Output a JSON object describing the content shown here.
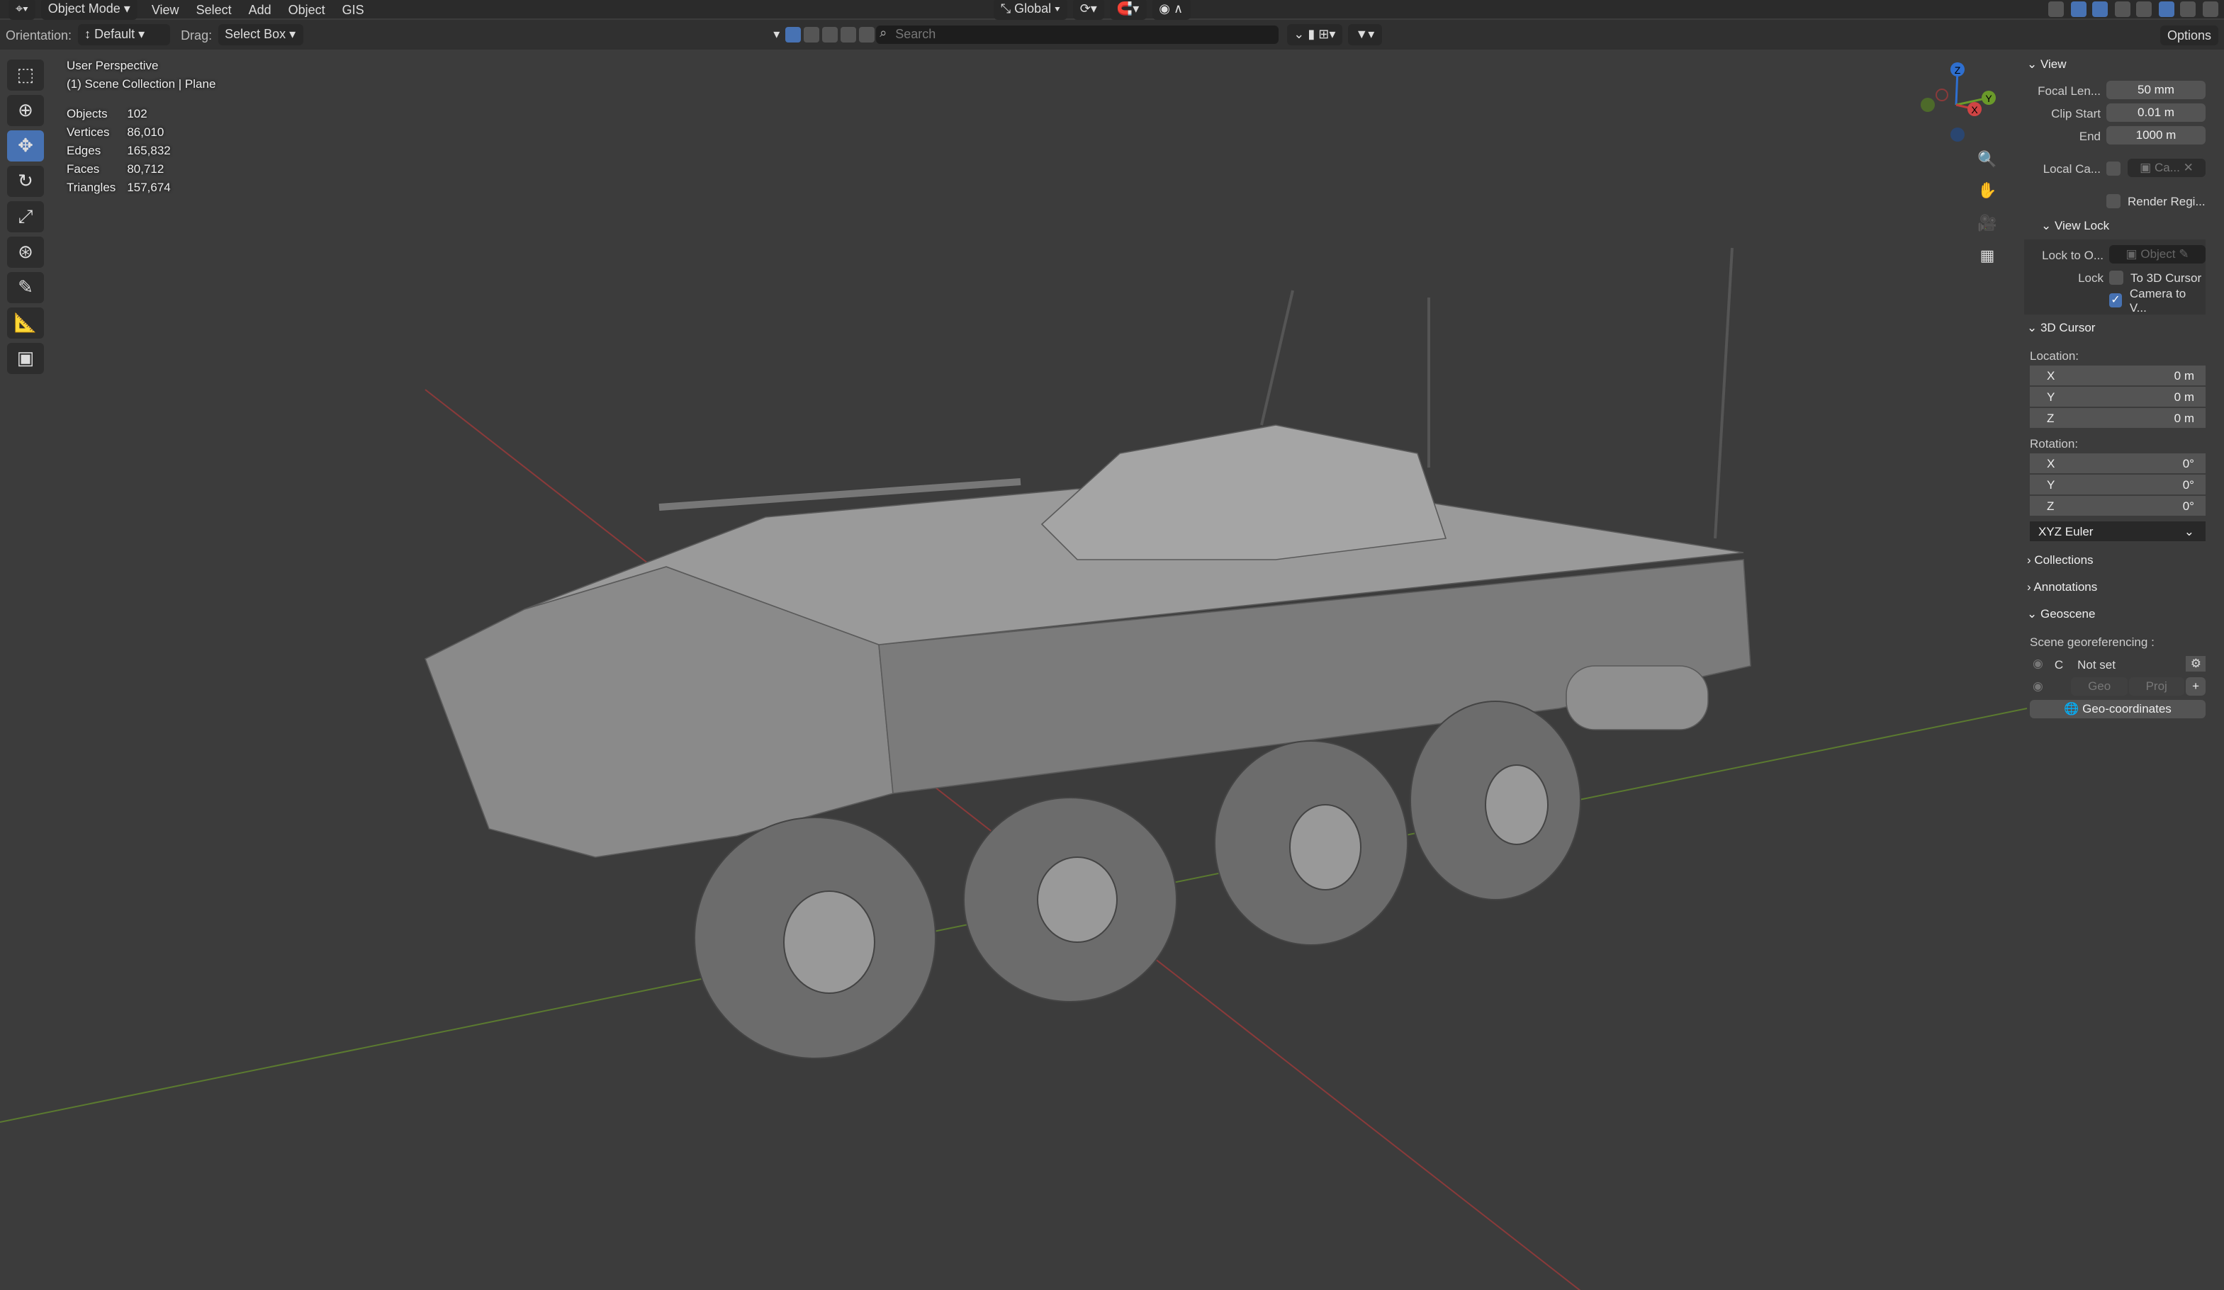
{
  "header": {
    "mode": "Object Mode",
    "menus": [
      "View",
      "Select",
      "Add",
      "Object",
      "GIS"
    ],
    "orientation_label": "Orientation:",
    "orientation": "Default",
    "drag_label": "Drag:",
    "drag": "Select Box",
    "transform_orientation": "Global",
    "search_placeholder": "Search",
    "options": "Options"
  },
  "tools": [
    "select-box",
    "cursor",
    "move",
    "rotate",
    "scale",
    "transform",
    "annotate",
    "measure",
    "add-cube"
  ],
  "viewport": {
    "view_name": "User Perspective",
    "collection": "(1) Scene Collection | Plane",
    "stats": [
      {
        "label": "Objects",
        "value": "102"
      },
      {
        "label": "Vertices",
        "value": "86,010"
      },
      {
        "label": "Edges",
        "value": "165,832"
      },
      {
        "label": "Faces",
        "value": "80,712"
      },
      {
        "label": "Triangles",
        "value": "157,674"
      }
    ],
    "gizmo": {
      "x": "X",
      "y": "Y",
      "z": "Z"
    }
  },
  "panel": {
    "view": {
      "title": "View",
      "focal_label": "Focal Len...",
      "focal": "50 mm",
      "clip_start_label": "Clip Start",
      "clip_start": "0.01 m",
      "end_label": "End",
      "end": "1000 m",
      "local_cam_label": "Local Ca...",
      "local_cam": "Ca...",
      "render_region": "Render Regi..."
    },
    "view_lock": {
      "title": "View Lock",
      "lock_to_label": "Lock to O...",
      "lock_to": "Object",
      "lock_label": "Lock",
      "to_cursor": "To 3D Cursor",
      "camera_to_view": "Camera to V..."
    },
    "cursor": {
      "title": "3D Cursor",
      "location_label": "Location:",
      "location": [
        {
          "axis": "X",
          "value": "0 m"
        },
        {
          "axis": "Y",
          "value": "0 m"
        },
        {
          "axis": "Z",
          "value": "0 m"
        }
      ],
      "rotation_label": "Rotation:",
      "rotation": [
        {
          "axis": "X",
          "value": "0°"
        },
        {
          "axis": "Y",
          "value": "0°"
        },
        {
          "axis": "Z",
          "value": "0°"
        }
      ],
      "rotation_mode": "XYZ Euler"
    },
    "collections": "Collections",
    "annotations": "Annotations",
    "geoscene": {
      "title": "Geoscene",
      "georef_label": "Scene georeferencing :",
      "crs": "C",
      "status": "Not set",
      "geo": "Geo",
      "proj": "Proj",
      "geo_coords": "Geo-coordinates"
    }
  }
}
